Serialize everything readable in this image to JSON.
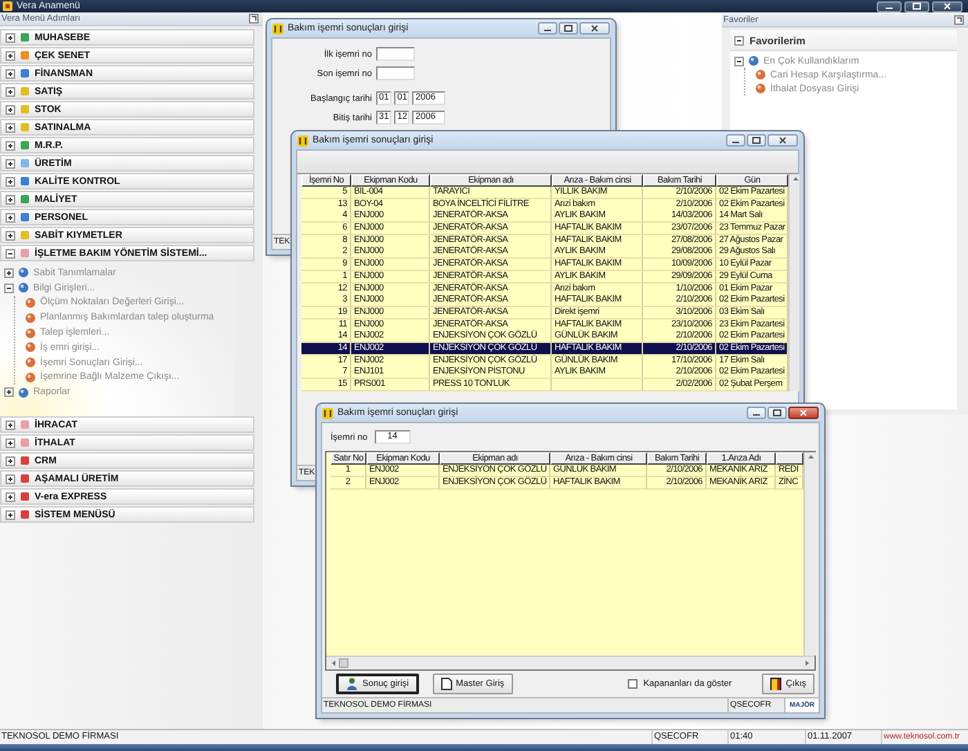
{
  "app": {
    "title": "Vera Anamenü"
  },
  "menu": {
    "title": "Vera Menü Adımları",
    "items": [
      {
        "label": "MUHASEBE",
        "expanded": false,
        "color": "#3aa655"
      },
      {
        "label": "ÇEK SENET",
        "expanded": false,
        "color": "#e8902a"
      },
      {
        "label": "FİNANSMAN",
        "expanded": false,
        "color": "#3d7fd1"
      },
      {
        "label": "SATIŞ",
        "expanded": false,
        "color": "#e0c020"
      },
      {
        "label": "STOK",
        "expanded": false,
        "color": "#e0c020"
      },
      {
        "label": "SATINALMA",
        "expanded": false,
        "color": "#e0c020"
      },
      {
        "label": "M.R.P.",
        "expanded": false,
        "color": "#3aa655"
      },
      {
        "label": "ÜRETİM",
        "expanded": false,
        "color": "#7fb8e8"
      },
      {
        "label": "KALİTE KONTROL",
        "expanded": false,
        "color": "#3d7fd1"
      },
      {
        "label": "MALİYET",
        "expanded": false,
        "color": "#3aa655"
      },
      {
        "label": "PERSONEL",
        "expanded": false,
        "color": "#3d7fd1"
      },
      {
        "label": "SABİT KIYMETLER",
        "expanded": false,
        "color": "#e0c020"
      },
      {
        "label": "İŞLETME BAKIM YÖNETİM SİSTEMİ...",
        "expanded": true,
        "color": "#e8a0a8",
        "children": [
          {
            "label": "Sabit Tanımlamalar",
            "expanded": false
          },
          {
            "label": "Bilgi Girişleri...",
            "expanded": true,
            "children": [
              {
                "label": "Ölçüm Noktaları Değerleri Girişi..."
              },
              {
                "label": "Planlanmış Bakımlardan talep oluşturma"
              },
              {
                "label": "Talep işlemleri..."
              },
              {
                "label": "İş emri girişi..."
              },
              {
                "label": "İşemri Sonuçları Girişi..."
              },
              {
                "label": "İşemrine Bağlı Malzeme Çıkışı..."
              }
            ]
          },
          {
            "label": "Raporlar",
            "expanded": false
          }
        ]
      },
      {
        "label": "İHRACAT",
        "expanded": false,
        "color": "#e8a0a8"
      },
      {
        "label": "İTHALAT",
        "expanded": false,
        "color": "#e8a0a8"
      },
      {
        "label": "CRM",
        "expanded": false,
        "color": "#d84040"
      },
      {
        "label": "AŞAMALI ÜRETİM",
        "expanded": false,
        "color": "#d84040"
      },
      {
        "label": "V-era EXPRESS",
        "expanded": false,
        "color": "#d84040"
      },
      {
        "label": "SİSTEM MENÜSÜ",
        "expanded": false,
        "color": "#d84040"
      }
    ]
  },
  "favorites": {
    "title": "Favoriler",
    "group": {
      "label": "Favorilerim",
      "expanded": true
    },
    "tree": [
      {
        "label": "En Çok Kullandıklarım",
        "expanded": true,
        "children": [
          {
            "label": "Cari Hesap Karşılaştırma..."
          },
          {
            "label": "İthalat Dosyası Girişi"
          }
        ]
      }
    ]
  },
  "windows": [
    {
      "kind": "filter",
      "title": "Bakım işemri sonuçları girişi",
      "active": false,
      "fields": [
        {
          "label": "İlk işemri no",
          "kind": "single"
        },
        {
          "label": "Son işemri no",
          "kind": "single"
        },
        {
          "label": "Başlangıç tarihi",
          "kind": "date",
          "values": [
            "01",
            "01",
            "2006"
          ]
        },
        {
          "label": "Bitiş tarihi",
          "kind": "date",
          "values": [
            "31",
            "12",
            "2006"
          ]
        }
      ],
      "status": [
        {
          "text": "TEK",
          "kind": "text"
        }
      ]
    },
    {
      "kind": "list",
      "title": "Bakım işemri sonuçları girişi",
      "active": false,
      "columns": [
        {
          "label": "İşemri No",
          "kind": "id"
        },
        {
          "label": "Ekipman Kodu",
          "kind": "text"
        },
        {
          "label": "Ekipman adı",
          "kind": "text"
        },
        {
          "label": "Arıza - Bakım cinsi",
          "kind": "text"
        },
        {
          "label": "Bakım Tarihi",
          "kind": "date"
        },
        {
          "label": "Gün",
          "kind": "text"
        }
      ],
      "rows": [
        {
          "selected": false,
          "cells": [
            "5",
            "BIL-004",
            "TARAYICI",
            "YILLIK BAKIM",
            "2/10/2006",
            "02 Ekim Pazartesi"
          ]
        },
        {
          "selected": false,
          "cells": [
            "13",
            "BOY-04",
            "BOYA İNCELTİCİ FİLİTRE",
            "Arızi bakım",
            "2/10/2006",
            "02 Ekim Pazartesi"
          ]
        },
        {
          "selected": false,
          "cells": [
            "4",
            "ENJ000",
            "JENERATÖR-AKSA",
            "AYLIK BAKIM",
            "14/03/2006",
            "14 Mart Salı"
          ]
        },
        {
          "selected": false,
          "cells": [
            "6",
            "ENJ000",
            "JENERATÖR-AKSA",
            "HAFTALIK BAKIM",
            "23/07/2006",
            "23 Temmuz Pazar"
          ]
        },
        {
          "selected": false,
          "cells": [
            "8",
            "ENJ000",
            "JENERATÖR-AKSA",
            "HAFTALIK BAKIM",
            "27/08/2006",
            "27 Ağustos Pazar"
          ]
        },
        {
          "selected": false,
          "cells": [
            "2",
            "ENJ000",
            "JENERATÖR-AKSA",
            "AYLIK BAKIM",
            "29/08/2006",
            "29 Ağustos Salı"
          ]
        },
        {
          "selected": false,
          "cells": [
            "9",
            "ENJ000",
            "JENERATÖR-AKSA",
            "HAFTALIK BAKIM",
            "10/09/2006",
            "10 Eylül Pazar"
          ]
        },
        {
          "selected": false,
          "cells": [
            "1",
            "ENJ000",
            "JENERATÖR-AKSA",
            "AYLIK BAKIM",
            "29/09/2006",
            "29 Eylül Cuma"
          ]
        },
        {
          "selected": false,
          "cells": [
            "12",
            "ENJ000",
            "JENERATÖR-AKSA",
            "Arızi bakım",
            "1/10/2006",
            "01 Ekim Pazar"
          ]
        },
        {
          "selected": false,
          "cells": [
            "3",
            "ENJ000",
            "JENERATÖR-AKSA",
            "HAFTALIK BAKIM",
            "2/10/2006",
            "02 Ekim Pazartesi"
          ]
        },
        {
          "selected": false,
          "cells": [
            "19",
            "ENJ000",
            "JENERATÖR-AKSA",
            "Direkt işemri",
            "3/10/2006",
            "03 Ekim Salı"
          ]
        },
        {
          "selected": false,
          "cells": [
            "11",
            "ENJ000",
            "JENERATÖR-AKSA",
            "HAFTALIK BAKIM",
            "23/10/2006",
            "23 Ekim Pazartesi"
          ]
        },
        {
          "selected": false,
          "cells": [
            "14",
            "ENJ002",
            "ENJEKSİYON ÇOK GÖZLÜ",
            "GÜNLÜK BAKIM",
            "2/10/2006",
            "02 Ekim Pazartesi"
          ]
        },
        {
          "selected": true,
          "cells": [
            "14",
            "ENJ002",
            "ENJEKSİYON ÇOK GÖZLÜ",
            "HAFTALIK BAKIM",
            "2/10/2006",
            "02 Ekim Pazartesi"
          ]
        },
        {
          "selected": false,
          "cells": [
            "17",
            "ENJ002",
            "ENJEKSİYON ÇOK GÖZLÜ",
            "GÜNLÜK BAKIM",
            "17/10/2006",
            "17 Ekim Salı"
          ]
        },
        {
          "selected": false,
          "cells": [
            "7",
            "ENJ101",
            "ENJEKSİYON PİSTONU",
            "AYLIK BAKIM",
            "2/10/2006",
            "02 Ekim Pazartesi"
          ]
        },
        {
          "selected": false,
          "cells": [
            "15",
            "PRS001",
            "PRESS 10 TON'LUK",
            null,
            "2/02/2006",
            "02 Şubat Perşem"
          ]
        }
      ],
      "status": [
        {
          "text": "TEK",
          "kind": "text"
        }
      ]
    },
    {
      "kind": "detail",
      "title": "Bakım işemri sonuçları girişi",
      "active": true,
      "record": {
        "label": "İşemri no",
        "value": "14"
      },
      "columns": [
        {
          "label": "Satır No",
          "kind": "index"
        },
        {
          "label": "Ekipman Kodu",
          "kind": "text"
        },
        {
          "label": "Ekipman adı",
          "kind": "text"
        },
        {
          "label": "Arıza - Bakım cinsi",
          "kind": "text"
        },
        {
          "label": "Bakım Tarihi",
          "kind": "date"
        },
        {
          "label": "1.Arıza Adı",
          "kind": "text"
        },
        {
          "kind": "text"
        }
      ],
      "rows": [
        {
          "selected": false,
          "cells": [
            "1",
            "ENJ002",
            "ENJEKSİYON ÇOK GÖZLÜ",
            "GÜNLÜK BAKIM",
            "2/10/2006",
            "MEKANİK ARIZ",
            "REDİ"
          ]
        },
        {
          "selected": false,
          "cells": [
            "2",
            "ENJ002",
            "ENJEKSİYON ÇOK GÖZLÜ",
            "HAFTALIK BAKIM",
            "2/10/2006",
            "MEKANİK ARIZ",
            "ZİNC"
          ]
        }
      ],
      "controls": [
        {
          "kind": "results",
          "label": "Sonuç girişi",
          "focused": true
        },
        {
          "kind": "master",
          "label": "Master Giriş",
          "focused": false
        },
        {
          "kind": "checkbox",
          "label": "Kapananları da göster",
          "checked": false
        },
        {
          "kind": "exit",
          "label": "Çıkış",
          "focused": false
        }
      ],
      "status": [
        {
          "text": "TEKNOSOL DEMO FİRMASI",
          "kind": "text"
        },
        {
          "text": "QSECOFR",
          "kind": "text"
        },
        {
          "text": "MAJÖR",
          "kind": "logo"
        }
      ]
    }
  ],
  "status_bar": [
    {
      "text": "TEKNOSOL DEMO FİRMASI",
      "kind": "text"
    },
    {
      "text": "QSECOFR",
      "kind": "text"
    },
    {
      "text": "01:40",
      "kind": "text"
    },
    {
      "text": "01.11.2007",
      "kind": "text"
    },
    {
      "text": "www.teknosol.com.tr",
      "kind": "link"
    }
  ]
}
